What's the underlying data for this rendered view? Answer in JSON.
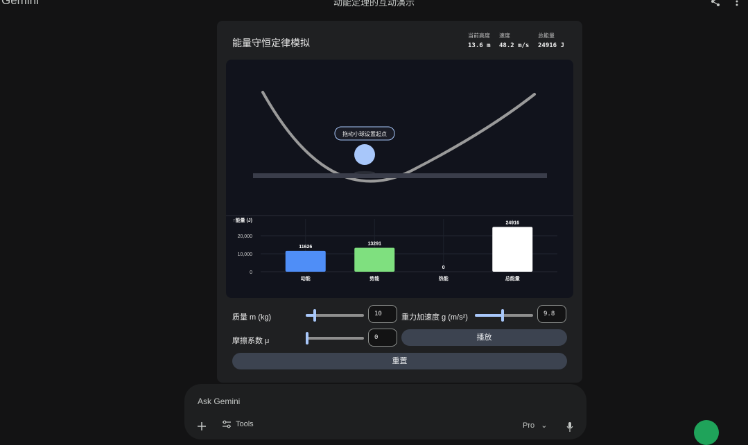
{
  "app": {
    "name": "Gemini",
    "title": "动能定理的互动演示"
  },
  "simulation": {
    "title": "能量守恒定律模拟",
    "stats": [
      {
        "label": "当前高度",
        "value": "13.6 m"
      },
      {
        "label": "速度",
        "value": "48.2 m/s"
      },
      {
        "label": "总能量",
        "value": "24916 J"
      }
    ],
    "ball_tooltip": "拖动小球设置起点",
    "chart_data": {
      "type": "bar",
      "ylabel": "↑能量 (J)",
      "yticks": [
        "20,000",
        "10,000",
        "0"
      ],
      "ytick_values": [
        20000,
        10000,
        0
      ],
      "ylim": [
        0,
        27000
      ],
      "categories": [
        "动能",
        "势能",
        "热能",
        "总能量"
      ],
      "values": [
        11626,
        13291,
        0,
        24916
      ],
      "value_labels": [
        "11626",
        "13291",
        "0",
        "24916"
      ],
      "colors": [
        "#4f8ef7",
        "#7fe07f",
        "#ff7043",
        "#ffffff"
      ]
    }
  },
  "controls": {
    "mass": {
      "label": "质量 m (kg)",
      "value": "10",
      "fraction": 0.15
    },
    "gravity": {
      "label": "重力加速度 g (m/s²)",
      "value": "9.8",
      "fraction": 0.48
    },
    "friction": {
      "label": "摩擦系数 μ",
      "value": "0",
      "fraction": 0.0
    },
    "play_label": "播放",
    "reset_label": "重置"
  },
  "prompt": {
    "placeholder": "Ask Gemini",
    "tools_label": "Tools",
    "model_label": "Pro"
  },
  "colors": {
    "accent": "#a8c7fa",
    "fab": "#1fa35a"
  }
}
